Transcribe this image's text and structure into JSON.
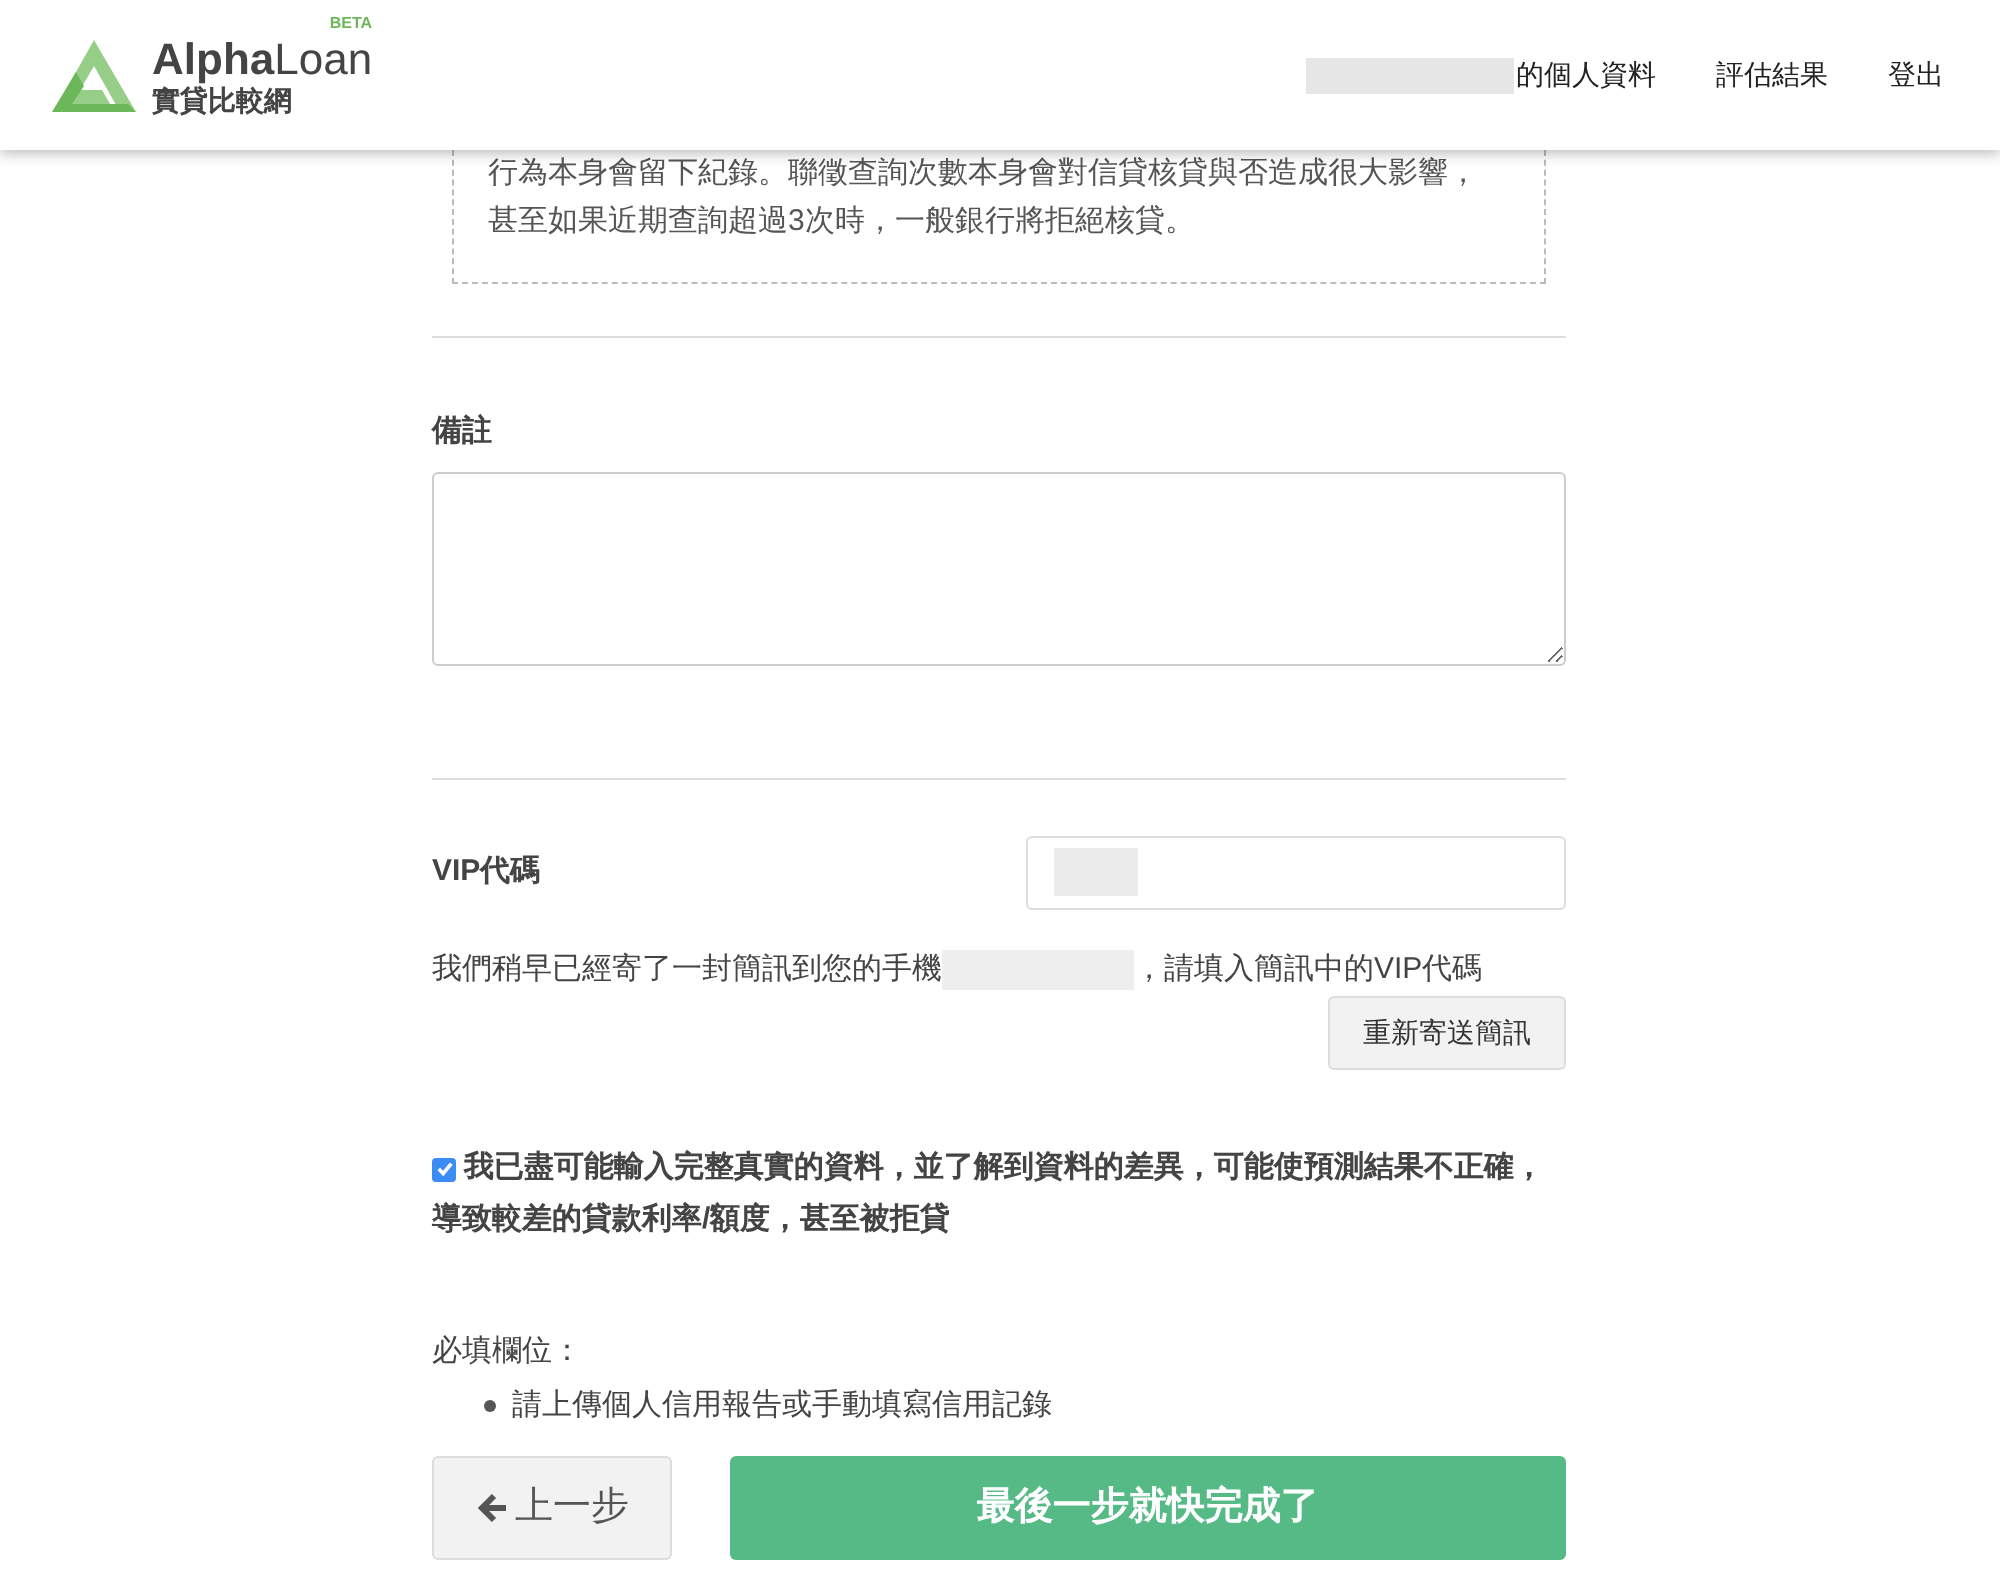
{
  "header": {
    "logo": {
      "brand_a": "Alpha",
      "brand_b": "Loan",
      "badge": "BETA",
      "subtitle": "實貸比較網"
    },
    "nav": [
      {
        "label": "的個人資料",
        "redacted_prefix": true
      },
      {
        "label": "評估結果",
        "redacted_prefix": false
      },
      {
        "label": "登出",
        "redacted_prefix": false
      }
    ]
  },
  "notice": {
    "text": "行為本身會留下紀錄。聯徵查詢次數本身會對信貸核貸與否造成很大影響，甚至如果近期查詢超過3次時，一般銀行將拒絕核貸。"
  },
  "remarks": {
    "label": "備註"
  },
  "vip": {
    "label": "VIP代碼",
    "message_before": "我們稍早已經寄了一封簡訊到您的手機",
    "message_after": "，請填入簡訊中的VIP代碼",
    "resend_button": "重新寄送簡訊"
  },
  "agreement": {
    "checked": true,
    "text": "我已盡可能輸入完整真實的資料，並了解到資料的差異，可能使預測結果不正確，導致較差的貸款利率/額度，甚至被拒貸"
  },
  "required": {
    "title": "必填欄位：",
    "items": [
      "請上傳個人信用報告或手動填寫信用記錄"
    ]
  },
  "buttons": {
    "back": "上一步",
    "submit": "最後一步就快完成了"
  }
}
